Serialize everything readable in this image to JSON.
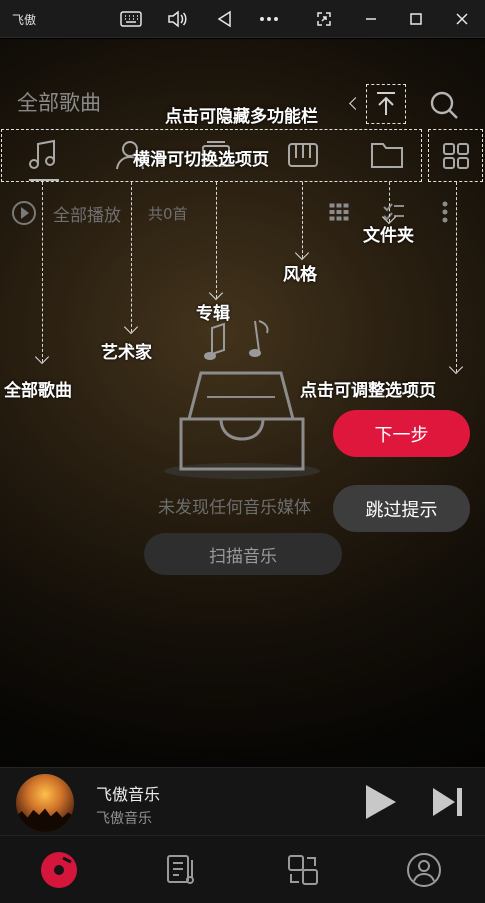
{
  "window": {
    "app_title": "飞傲",
    "controls": [
      "keyboard-icon",
      "volume-icon",
      "back-triangle-icon",
      "more-icon",
      "screenshot-icon",
      "minimize-icon",
      "maximize-icon",
      "close-icon"
    ]
  },
  "header": {
    "title": "全部歌曲"
  },
  "toolbar": {
    "play_all": "全部播放",
    "count": "共0首"
  },
  "tabs": [
    "music-note-icon",
    "artist-icon",
    "album-icon",
    "piano-icon",
    "folder-icon"
  ],
  "annotations": {
    "hide_toolbar": "点击可隐藏多功能栏",
    "swipe_tabs": "横滑可切换选项页",
    "folder": "文件夹",
    "style": "风格",
    "album": "专辑",
    "artist": "艺术家",
    "all_songs": "全部歌曲",
    "adjust_tabs": "点击可调整选项页"
  },
  "empty_state": {
    "message": "未发现任何音乐媒体",
    "scan_button": "扫描音乐"
  },
  "guide": {
    "next_button": "下一步",
    "skip_button": "跳过提示"
  },
  "player": {
    "song": "飞傲音乐",
    "artist": "飞傲音乐"
  },
  "nav": [
    "disc-icon",
    "playlist-icon",
    "switch-icon",
    "profile-icon"
  ],
  "colors": {
    "accent": "#e0173d"
  }
}
